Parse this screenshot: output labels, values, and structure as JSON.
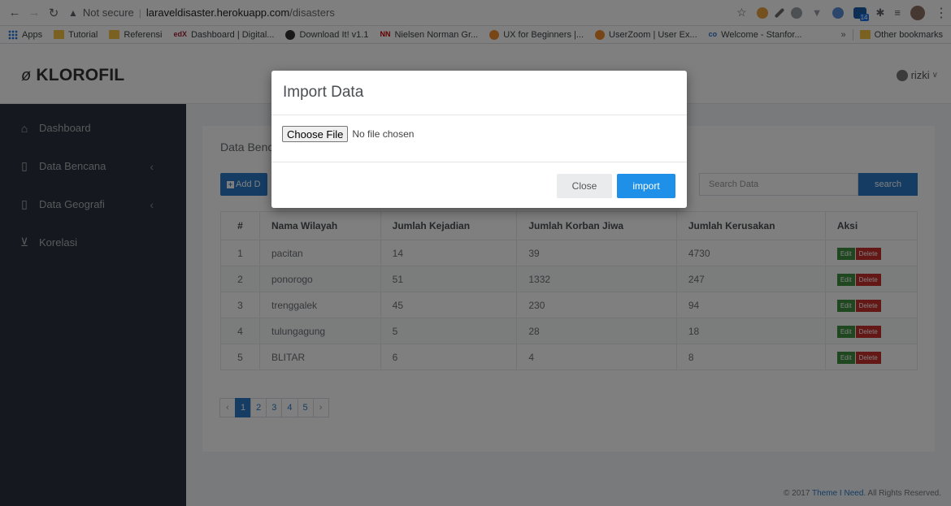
{
  "browser": {
    "security_label": "Not secure",
    "url_host": "laraveldisaster.herokuapp.com",
    "url_path": "/disasters",
    "ext_badge": "14"
  },
  "bookmarks": [
    {
      "label": "Apps",
      "icon": "apps-grid-icon"
    },
    {
      "label": "Tutorial",
      "icon": "folder-icon"
    },
    {
      "label": "Referensi",
      "icon": "folder-icon"
    },
    {
      "label": "Dashboard | Digital...",
      "icon": "edx-icon"
    },
    {
      "label": "Download It! v1.1",
      "icon": "github-icon"
    },
    {
      "label": "Nielsen Norman Gr...",
      "icon": "nn-icon"
    },
    {
      "label": "UX for Beginners |...",
      "icon": "fox-icon"
    },
    {
      "label": "UserZoom | User Ex...",
      "icon": "fox-icon"
    },
    {
      "label": "Welcome - Stanfor...",
      "icon": "coursera-icon"
    }
  ],
  "bookmarks_more": "»",
  "bookmarks_other": "Other bookmarks",
  "app": {
    "brand": "KLOROFIL",
    "user_name": "rizki",
    "sidebar": [
      {
        "label": "Dashboard",
        "icon": "home-icon",
        "has_caret": false
      },
      {
        "label": "Data Bencana",
        "icon": "file-icon",
        "has_caret": true
      },
      {
        "label": "Data Geografi",
        "icon": "file-icon",
        "has_caret": true
      },
      {
        "label": "Korelasi",
        "icon": "chart-icon",
        "has_caret": false
      }
    ],
    "panel_title": "Data Benc",
    "add_button": "Add D",
    "search_placeholder": "Search Data",
    "search_button": "search",
    "table": {
      "headers": [
        "#",
        "Nama Wilayah",
        "Jumlah Kejadian",
        "Jumlah Korban Jiwa",
        "Jumlah Kerusakan",
        "Aksi"
      ],
      "rows": [
        [
          "1",
          "pacitan",
          "14",
          "39",
          "4730"
        ],
        [
          "2",
          "ponorogo",
          "51",
          "1332",
          "247"
        ],
        [
          "3",
          "trenggalek",
          "45",
          "230",
          "94"
        ],
        [
          "4",
          "tulungagung",
          "5",
          "28",
          "18"
        ],
        [
          "5",
          "BLITAR",
          "6",
          "4",
          "8"
        ]
      ],
      "edit_label": "Edit",
      "delete_label": "Delete"
    },
    "pagination": {
      "prev": "‹",
      "pages": [
        "1",
        "2",
        "3",
        "4",
        "5"
      ],
      "active": "1",
      "next": "›"
    },
    "footer": {
      "prefix": "© 2017 ",
      "link": "Theme I Need",
      "suffix": ". All Rights Reserved."
    }
  },
  "modal": {
    "title": "Import Data",
    "file_button": "Choose File",
    "file_status": "No file chosen",
    "close_button": "Close",
    "import_button": "import"
  },
  "colors": {
    "primary": "#2b7bc8",
    "sidebar_bg": "#2b333e",
    "import_button": "#1e90e8",
    "edit": "#3e8e41",
    "delete": "#c9302c"
  }
}
